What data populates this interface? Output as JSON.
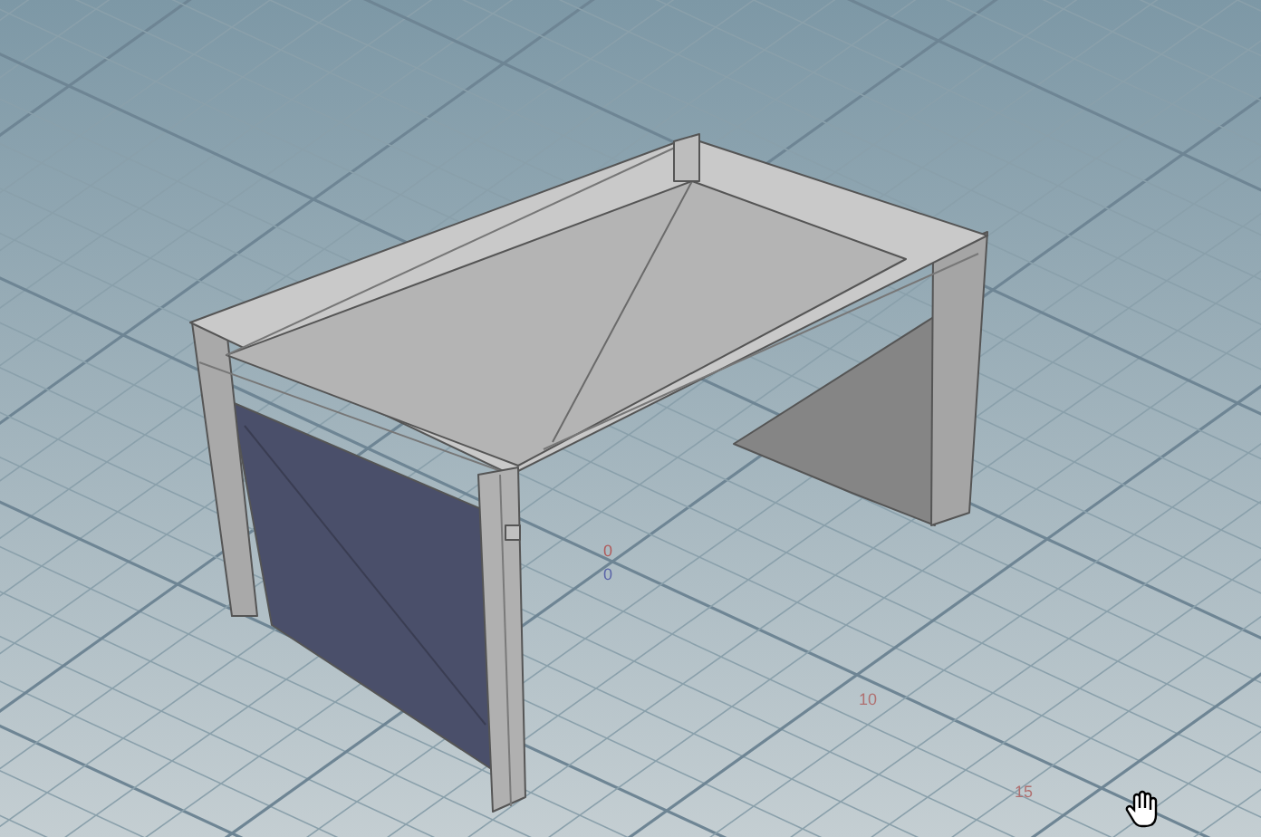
{
  "viewport": {
    "grid_labels": [
      {
        "text": "0",
        "color": "#b05a5a"
      },
      {
        "text": "0",
        "color": "#5a64a8"
      },
      {
        "text": "10",
        "color": "#b07070"
      },
      {
        "text": "15",
        "color": "#b07070"
      }
    ]
  }
}
